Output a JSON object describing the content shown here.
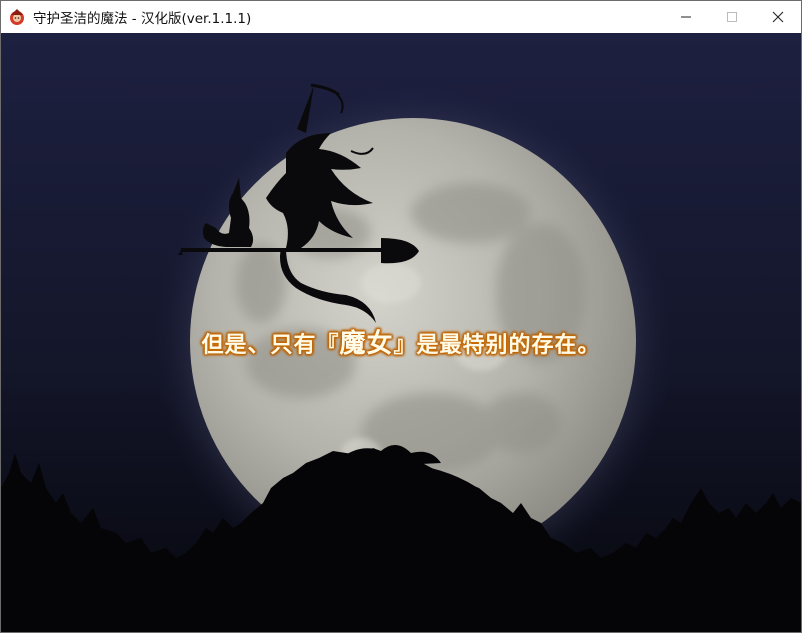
{
  "window": {
    "title": "守护圣洁的魔法 - 汉化版(ver.1.1.1)",
    "icon": "game-app-icon",
    "controls": {
      "minimize_icon": "minimize-icon",
      "maximize_icon": "maximize-icon",
      "close_icon": "close-icon"
    }
  },
  "scene": {
    "description_elements": [
      "full-moon",
      "witch-on-broom-silhouette",
      "cat-silhouette",
      "tree-line-silhouette"
    ],
    "colors": {
      "sky_top": "#1c1f3a",
      "sky_bottom": "#070810",
      "moon": "#bdbcb4",
      "text_glow": "#e08a10"
    }
  },
  "dialogue": {
    "part1": "但是、只有『",
    "emphasis": "魔女",
    "part2": "』是最特别的存在。"
  }
}
